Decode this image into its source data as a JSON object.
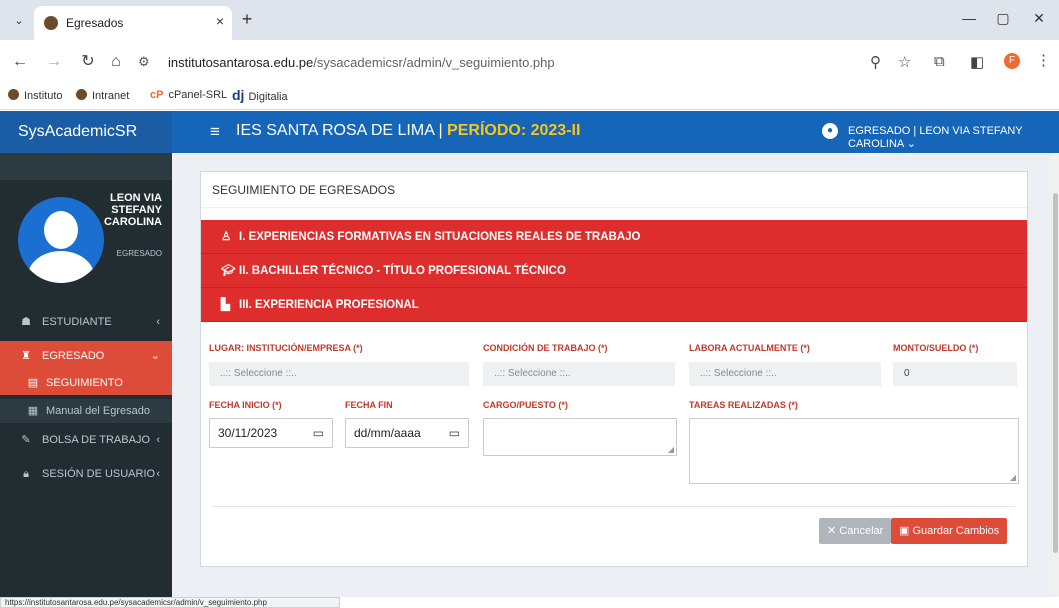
{
  "browser": {
    "tab_title": "Egresados",
    "url_prefix": "institutosantarosa.edu.pe",
    "url_path": "/sysacademicsr/admin/v_seguimiento.php",
    "profile_initial": "F",
    "bookmarks": [
      "Instituto",
      "Intranet",
      "cPanel-SRL",
      "Digitalia"
    ],
    "status_url": "https://institutosantarosa.edu.pe/sysacademicsr/admin/v_seguimiento.php"
  },
  "header": {
    "brand": "SysAcademicSR",
    "institute": "IES SANTA ROSA DE LIMA | ",
    "periodo": "PERÍODO: 2023-II",
    "user_label": "EGRESADO | LEON VIA STEFANY CAROLINA"
  },
  "sidebar": {
    "user_name": "LEON VIA STEFANY CAROLINA",
    "user_role": "EGRESADO",
    "menu": {
      "estudiante": "ESTUDIANTE",
      "egresado": "EGRESADO",
      "seguimiento": "SEGUIMIENTO",
      "manual": "Manual del Egresado",
      "bolsa": "BOLSA DE TRABAJO",
      "sesion": "SESIÓN DE USUARIO"
    }
  },
  "main": {
    "title": "SEGUIMIENTO DE EGRESADOS",
    "sections": [
      "I. EXPERIENCIAS FORMATIVAS EN SITUACIONES REALES DE TRABAJO",
      "II. BACHILLER TÉCNICO - TÍTULO PROFESIONAL TÉCNICO",
      "III. EXPERIENCIA PROFESIONAL"
    ],
    "form": {
      "lugar_label": "LUGAR: INSTITUCIÓN/EMPRESA (*)",
      "lugar_value": "..:: Seleccione ::..",
      "condicion_label": "CONDICIÓN DE TRABAJO (*)",
      "condicion_value": "..:: Seleccione ::..",
      "labora_label": "LABORA ACTUALMENTE (*)",
      "labora_value": "..:: Seleccione ::..",
      "monto_label": "MONTO/SUELDO (*)",
      "monto_value": "0",
      "fecha_inicio_label": "FECHA INICIO (*)",
      "fecha_inicio_value": "30/11/2023",
      "fecha_fin_label": "FECHA FIN",
      "fecha_fin_value": "dd/mm/aaaa",
      "cargo_label": "CARGO/PUESTO (*)",
      "tareas_label": "TAREAS REALIZADAS (*)"
    },
    "buttons": {
      "cancel": "Cancelar",
      "save": "Guardar Cambios"
    }
  }
}
